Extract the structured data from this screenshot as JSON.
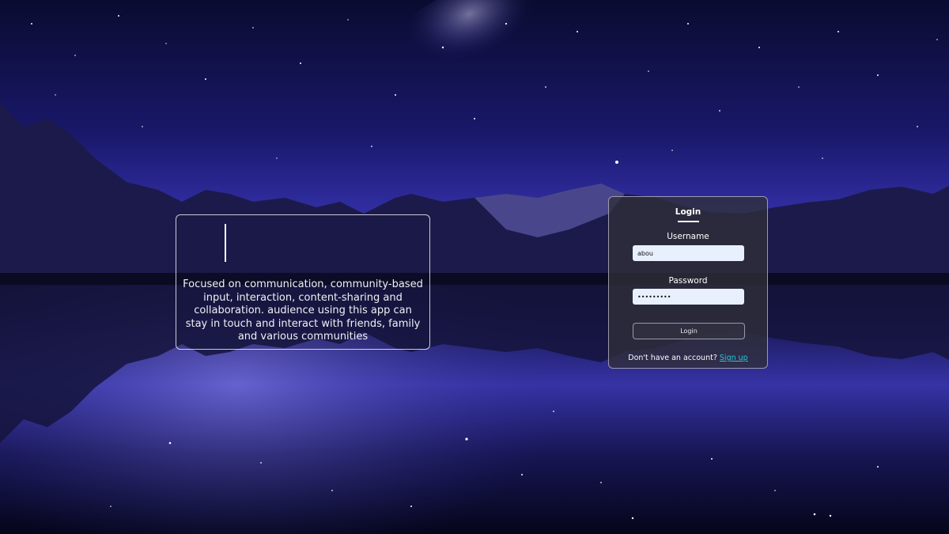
{
  "intro": {
    "description": "Focused on communication, community-based input, interaction, content-sharing and collaboration. audience using this app can stay in touch and interact with friends, family and various communities"
  },
  "login": {
    "title": "Login",
    "username_label": "Username",
    "username_value": "abou",
    "password_label": "Password",
    "password_value": "abou12345",
    "submit_label": "Login",
    "signup_prompt": "Don't have an account?",
    "signup_link": "Sign up"
  },
  "colors": {
    "sky": "#0b0a2e",
    "accent_link": "#27c7d6",
    "input_bg": "#e8f0fe"
  },
  "icons": {
    "background": "starry-mountain-lake-image"
  }
}
